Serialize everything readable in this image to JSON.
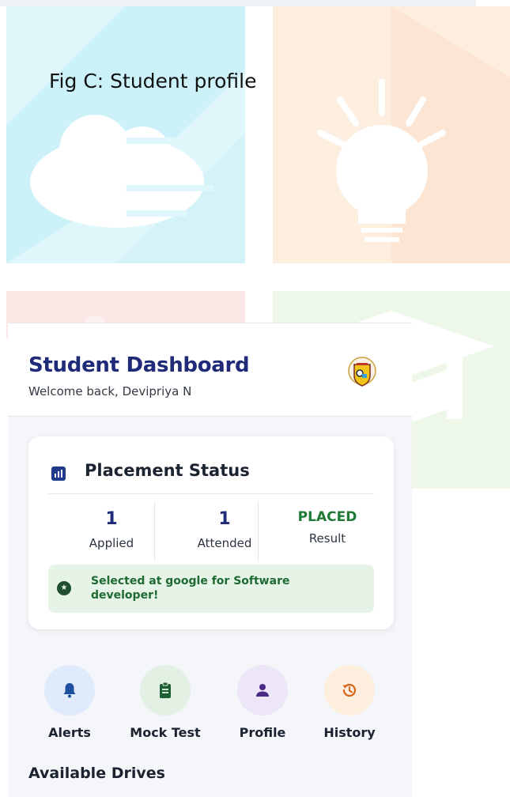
{
  "caption": "Fig C: Student profile",
  "header": {
    "title": "Student Dashboard",
    "subtitle": "Welcome back, Devipriya N",
    "logo_icon": "college-crest-logo"
  },
  "placement": {
    "title": "Placement Status",
    "icon": "bar-chart-icon",
    "stats": [
      {
        "value": "1",
        "label": "Applied"
      },
      {
        "value": "1",
        "label": "Attended"
      },
      {
        "value": "PLACED",
        "label": "Result"
      }
    ],
    "banner_icon": "star-badge-icon",
    "banner_text": "Selected at google for Software developer!"
  },
  "actions": [
    {
      "label": "Alerts",
      "icon": "bell-icon",
      "color": "#1f4fa0"
    },
    {
      "label": "Mock Test",
      "icon": "clipboard-icon",
      "color": "#1f5f34"
    },
    {
      "label": "Profile",
      "icon": "person-icon",
      "color": "#4a2a86"
    },
    {
      "label": "History",
      "icon": "history-icon",
      "color": "#d9641a"
    }
  ],
  "section_title": "Available Drives",
  "colors": {
    "primary": "#1f2a78",
    "success": "#1e7a34",
    "success_bg": "#e6f4e8",
    "tile_blue": "#e0f6fb",
    "tile_orange": "#fdeee0",
    "tile_red": "#fbe6e6",
    "tile_green": "#eef8ea"
  }
}
